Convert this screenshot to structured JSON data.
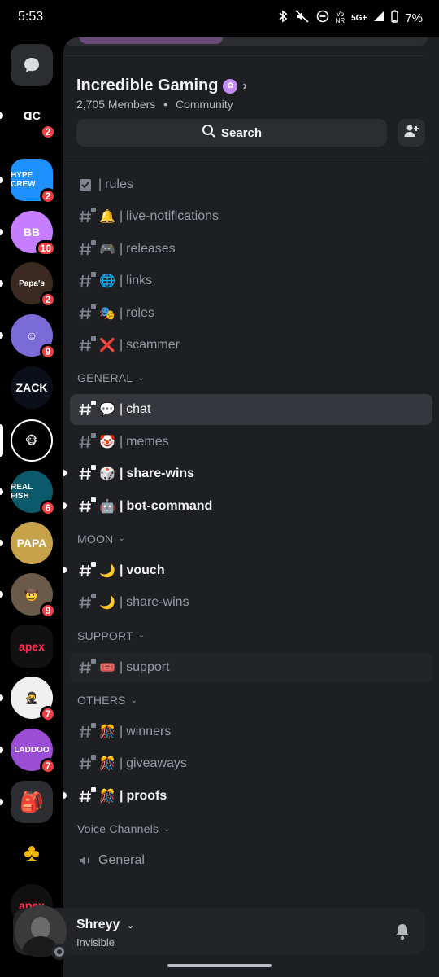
{
  "status": {
    "time": "5:53",
    "battery": "7%",
    "network": "5G+",
    "carrier_top": "Vo",
    "carrier_bottom": "NR"
  },
  "rail": {
    "dm_icon": "chat-bubble-icon",
    "servers": [
      {
        "label": "ꓷC",
        "badge": "2",
        "bg": "#000000"
      },
      {
        "label": "HYPE CREW",
        "badge": "2",
        "bg": "#1e90ff"
      },
      {
        "label": "BB",
        "badge": "10",
        "bg": "#c77dff"
      },
      {
        "label": "Papa's",
        "badge": "2",
        "bg": "#3b2a1f"
      },
      {
        "label": "☺",
        "badge": "9",
        "bg": "#7b6bd6"
      },
      {
        "label": "ZACK",
        "badge": "",
        "bg": "#0a0f1a"
      },
      {
        "label": "🐵",
        "badge": "",
        "bg": "#000000"
      },
      {
        "label": "REAL FISH",
        "badge": "6",
        "bg": "#0b5a6b"
      },
      {
        "label": "PAPA",
        "badge": "",
        "bg": "#c8a24a"
      },
      {
        "label": "🤠",
        "badge": "9",
        "bg": "#6b5a4a"
      },
      {
        "label": "apex",
        "badge": "",
        "bg": "#111111"
      },
      {
        "label": "🥷",
        "badge": "7",
        "bg": "#f0f0f0"
      },
      {
        "label": "LADDOO",
        "badge": "7",
        "bg": "#9b4dd6"
      },
      {
        "label": "🎒",
        "badge": "",
        "bg": "#2b2d31"
      },
      {
        "label": "♣",
        "badge": "",
        "bg": "#000000"
      },
      {
        "label": "apex",
        "badge": "",
        "bg": "#111111"
      }
    ]
  },
  "server": {
    "name": "Incredible Gaming",
    "members": "2,705 Members",
    "type": "Community",
    "search_label": "Search"
  },
  "channels_top": [
    {
      "emoji": "",
      "name": "rules",
      "icon": "rules-icon",
      "state": "normal"
    },
    {
      "emoji": "🔔",
      "name": "live-notifications",
      "icon": "hash-lock-icon",
      "state": "normal"
    },
    {
      "emoji": "🎮",
      "name": "releases",
      "icon": "hash-lock-icon",
      "state": "normal"
    },
    {
      "emoji": "🌐",
      "name": "links",
      "icon": "hash-lock-icon",
      "state": "normal"
    },
    {
      "emoji": "🎭",
      "name": "roles",
      "icon": "hash-lock-icon",
      "state": "normal"
    },
    {
      "emoji": "❌",
      "name": "scammer",
      "icon": "hash-lock-icon",
      "state": "normal"
    }
  ],
  "categories": [
    {
      "name": "GENERAL",
      "channels": [
        {
          "emoji": "💬",
          "name": "chat",
          "state": "selected"
        },
        {
          "emoji": "🤡",
          "name": "memes",
          "state": "normal"
        },
        {
          "emoji": "🎲",
          "name": "share-wins",
          "state": "unread"
        },
        {
          "emoji": "🤖",
          "name": "bot-command",
          "state": "unread"
        }
      ]
    },
    {
      "name": "MOON",
      "channels": [
        {
          "emoji": "🌙",
          "name": "vouch",
          "state": "unread"
        },
        {
          "emoji": "🌙",
          "name": "share-wins",
          "state": "normal"
        }
      ]
    },
    {
      "name": "SUPPORT",
      "channels": [
        {
          "emoji": "🎟️",
          "name": "support",
          "state": "hovered"
        }
      ]
    },
    {
      "name": "OTHERS",
      "channels": [
        {
          "emoji": "🎊",
          "name": "winners",
          "state": "normal"
        },
        {
          "emoji": "🎊",
          "name": "giveaways",
          "state": "normal"
        },
        {
          "emoji": "🎊",
          "name": "proofs",
          "state": "unread"
        }
      ]
    }
  ],
  "voice": {
    "category": "Voice Channels",
    "channel": "General"
  },
  "user": {
    "name": "Shreyy",
    "status": "Invisible"
  }
}
